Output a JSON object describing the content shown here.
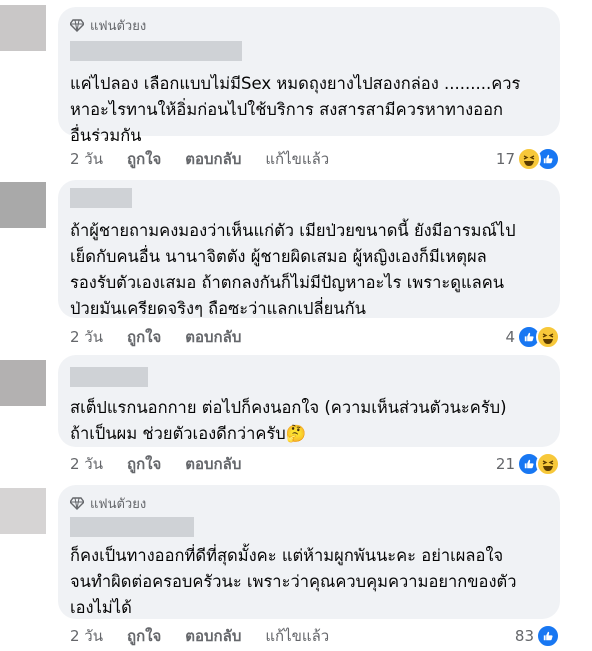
{
  "comments": [
    {
      "badge": "แฟนตัวยง",
      "text": "แค่ไปลอง เลือกแบบไม่มีSex หมดถุงยางไปสองกล่อง .........ควร\nหาอะไรทานให้อิ่มก่อนไปใช้บริการ สงสารสามีควรหาทางออก\nอื่นร่วมกัน",
      "time": "2 วัน",
      "like": "ถูกใจ",
      "reply": "ตอบกลับ",
      "edited": "แก้ไขแล้ว",
      "count": "17"
    },
    {
      "text": "ถ้าผู้ชายถามคงมองว่าเห็นแก่ตัว เมียป่วยขนาดนี้ ยังมีอารมณ์ไป\nเย็ดกับคนอื่น นานาจิตตัง ผู้ชายผิดเสมอ ผู้หญิงเองก็มีเหตุผล\nรองรับตัวเองเสมอ ถ้าตกลงกันก็ไม่มีปัญหาอะไร เพราะดูแลคน\nป่วยมันเครียดจริงๆ ถือซะว่าแลกเปลี่ยนกัน",
      "time": "2 วัน",
      "like": "ถูกใจ",
      "reply": "ตอบกลับ",
      "count": "4"
    },
    {
      "text": "สเต็ปแรกนอกกาย ต่อไปก็คงนอกใจ (ความเห็นส่วนตัวนะครับ)\nถ้าเป็นผม ช่วยตัวเองดีกว่าครับ🤔",
      "time": "2 วัน",
      "like": "ถูกใจ",
      "reply": "ตอบกลับ",
      "count": "21"
    },
    {
      "badge": "แฟนตัวยง",
      "text": "ก็คงเป็นทางออกที่ดีที่สุดมั้งคะ แต่ห้ามผูกพันนะคะ อย่าเผลอใจ\nจนทำผิดต่อครอบครัวนะ เพราะว่าคุณควบคุมความอยากของตัว\nเองไม่ได้",
      "time": "2 วัน",
      "like": "ถูกใจ",
      "reply": "ตอบกลับ",
      "edited": "แก้ไขแล้ว",
      "count": "83"
    }
  ],
  "colors": {
    "bubble": "#f0f2f5",
    "meta": "#65676b",
    "like": "#1877f2",
    "haha": "#f7c83a"
  }
}
